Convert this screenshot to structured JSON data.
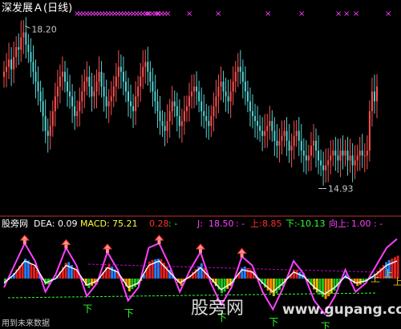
{
  "title": "深发展Ａ(日线)",
  "colors": {
    "background": "#000000",
    "up": "#ff5050",
    "down": "#54d2d2",
    "price_label": "#c8c8c8",
    "marker_pink": "#ff40ff",
    "dea_white": "#ffffff",
    "macd_yellow": "#ffff40",
    "buy_red": "#ff3030",
    "sell_green": "#30ff30",
    "divider": "#c03030",
    "guide_magenta": "#c000c0",
    "bar_blue": "#2080ff",
    "bar_red": "#e02020",
    "bar_green": "#20c020",
    "bar_yellow": "#e0c000",
    "bar_orange": "#ff8c00"
  },
  "chart_data": [
    {
      "type": "candlestick",
      "title": "深发展Ａ(日线)",
      "ylim": [
        14.5,
        18.4
      ],
      "x": [
        1,
        2,
        3,
        4,
        5,
        6,
        7,
        8,
        9,
        10,
        11,
        12,
        13,
        14,
        15,
        16,
        17,
        18,
        19,
        20,
        21,
        22,
        23,
        24,
        25,
        26,
        27,
        28,
        29,
        30,
        31,
        32,
        33,
        34,
        35,
        36,
        37,
        38,
        39,
        40,
        41,
        42,
        43,
        44,
        45,
        46,
        47,
        48,
        49,
        50,
        51,
        52,
        53,
        54,
        55,
        56,
        57,
        58,
        59,
        60,
        61,
        62,
        63,
        64,
        65,
        66,
        67,
        68,
        69,
        70,
        71,
        72,
        73,
        74,
        75,
        76,
        77,
        78,
        79,
        80,
        81,
        82,
        83,
        84,
        85,
        86,
        87,
        88,
        89,
        90,
        91,
        92,
        93,
        94,
        95,
        96,
        97,
        98,
        99,
        100,
        101,
        102,
        103,
        104,
        105,
        106,
        107,
        108,
        109,
        110,
        111,
        112,
        113,
        114,
        115,
        116,
        117,
        118,
        119,
        120,
        121,
        122,
        123,
        124,
        125,
        126,
        127,
        128,
        129,
        130,
        131,
        132,
        133,
        134,
        135,
        136,
        137,
        138,
        139,
        140,
        141,
        142,
        143,
        144,
        145,
        146,
        147,
        148,
        149,
        150,
        151,
        152,
        153,
        154
      ],
      "close": [
        17.3,
        17.4,
        17.55,
        17.35,
        17.6,
        17.8,
        17.75,
        18.0,
        18.1,
        17.85,
        17.7,
        17.5,
        17.3,
        17.1,
        16.9,
        16.7,
        16.4,
        16.1,
        16.0,
        16.2,
        16.5,
        16.8,
        17.0,
        17.2,
        17.3,
        17.1,
        16.9,
        16.8,
        16.6,
        16.4,
        16.5,
        16.7,
        16.9,
        17.1,
        17.2,
        17.0,
        16.8,
        16.9,
        17.1,
        17.3,
        17.0,
        16.8,
        16.6,
        16.7,
        16.8,
        17.0,
        17.2,
        17.4,
        17.3,
        17.1,
        16.9,
        16.7,
        16.6,
        16.5,
        16.8,
        17.0,
        17.2,
        17.4,
        17.5,
        17.3,
        17.1,
        16.9,
        16.7,
        16.5,
        16.3,
        16.2,
        16.1,
        16.3,
        16.5,
        16.7,
        16.6,
        16.4,
        16.2,
        16.3,
        16.5,
        16.6,
        16.8,
        16.9,
        17.0,
        16.9,
        16.7,
        16.5,
        16.4,
        16.3,
        16.2,
        16.4,
        16.6,
        16.8,
        17.0,
        17.1,
        16.9,
        16.8,
        16.7,
        16.9,
        17.1,
        17.3,
        17.4,
        17.3,
        17.1,
        16.9,
        16.7,
        16.5,
        16.4,
        16.3,
        16.2,
        16.1,
        16.0,
        16.1,
        16.2,
        16.3,
        16.1,
        15.9,
        15.8,
        15.9,
        16.0,
        16.1,
        15.9,
        15.7,
        15.8,
        16.0,
        16.1,
        15.9,
        15.7,
        15.6,
        15.5,
        15.6,
        15.8,
        15.9,
        15.7,
        15.5,
        15.4,
        15.3,
        15.4,
        15.5,
        15.6,
        15.7,
        15.6,
        15.5,
        15.7,
        15.6,
        15.7,
        15.5,
        15.6,
        15.4,
        15.5,
        15.6,
        15.7,
        15.6,
        15.6,
        15.7,
        16.5,
        16.9,
        16.7,
        17.0
      ],
      "annotations": [
        {
          "text": "18.20",
          "x": 9,
          "value": 18.2
        },
        {
          "text": "14.93",
          "x": 129,
          "value": 14.93
        }
      ]
    },
    {
      "type": "line",
      "title": "",
      "legend": "top",
      "ylim": [
        -20,
        20
      ],
      "x": [
        1,
        5,
        9,
        13,
        17,
        21,
        25,
        29,
        33,
        37,
        41,
        45,
        49,
        53,
        57,
        61,
        65,
        69,
        73,
        77,
        81,
        85,
        89,
        93,
        97,
        101,
        105,
        109,
        113,
        117,
        121,
        125,
        129,
        133,
        137,
        141,
        145,
        149,
        153
      ],
      "series": [
        {
          "name": "J",
          "values": [
            -4,
            6,
            16,
            8,
            -6,
            2,
            14,
            6,
            -8,
            -2,
            12,
            4,
            -10,
            -4,
            14,
            16,
            6,
            -6,
            4,
            12,
            -2,
            -12,
            -4,
            10,
            6,
            -6,
            -14,
            -4,
            8,
            2,
            -10,
            -16,
            -8,
            4,
            -6,
            -2,
            6,
            14,
            18
          ]
        },
        {
          "name": "DEA",
          "values": [
            -2,
            2,
            8,
            6,
            -2,
            0,
            6,
            4,
            -3,
            -1,
            5,
            3,
            -4,
            -2,
            6,
            8,
            3,
            -2,
            1,
            5,
            0,
            -5,
            -2,
            4,
            3,
            -2,
            -6,
            -2,
            3,
            1,
            -4,
            -7,
            -4,
            1,
            -2,
            -1,
            2,
            6,
            8
          ]
        }
      ],
      "header": [
        {
          "label": "DEA:",
          "value": "0.09"
        },
        {
          "label": "MACD:",
          "value": "75.21"
        },
        {
          "label": "",
          "value": "0.28"
        },
        {
          "label": "J:",
          "value": "18.50"
        },
        {
          "label": "上:",
          "value": "8.85"
        },
        {
          "label": "下:",
          "value": "-10.13"
        },
        {
          "label": "向上:",
          "value": "1.00"
        }
      ],
      "marker_labels": {
        "buy": "上",
        "sell": "下"
      }
    }
  ],
  "watermark": {
    "brand": "股旁网",
    "site": "www.gupang.com",
    "overlay_top": "股旁网",
    "overlay_bottom": "用到未来数据"
  }
}
